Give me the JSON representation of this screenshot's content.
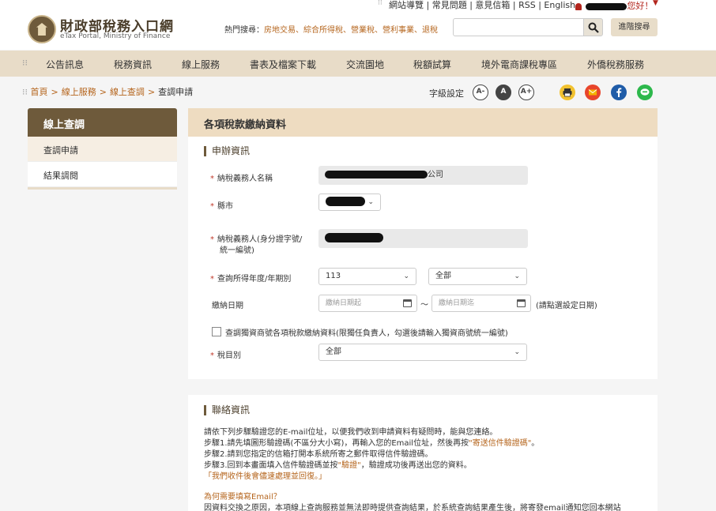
{
  "util": {
    "links": "網站導覽 | 常見問題 | 意見信箱 | RSS | English",
    "greeting": "您好！"
  },
  "header": {
    "brand_cn": "財政部稅務入口網",
    "brand_en": "eTax Portal, Ministry of Finance",
    "hot_label": "熱門搜尋：",
    "hot_keywords": "房地交易、綜合所得稅、營業稅、營利事業、退稅",
    "search_placeholder": "",
    "advanced_search": "進階搜尋"
  },
  "nav": {
    "items": [
      "公告訊息",
      "稅務資訊",
      "線上服務",
      "書表及檔案下載",
      "交流園地",
      "稅額試算",
      "境外電商課稅專區",
      "外僑稅務服務"
    ]
  },
  "breadcrumb": {
    "home": "首頁",
    "level1": "線上服務",
    "level2": "線上查調",
    "current": "查調申請",
    "sep": ">"
  },
  "font_size": {
    "label": "字級設定",
    "small": "A-",
    "normal": "A",
    "large": "A+"
  },
  "sidebar": {
    "title": "線上查調",
    "items": [
      "查調申請",
      "結果調閱"
    ]
  },
  "form": {
    "card_title": "各項稅款繳納資料",
    "section_title": "申辦資訊",
    "taxpayer_name_label": "納稅義務人名稱",
    "taxpayer_name_suffix": "公司",
    "city_label": "縣市",
    "taxpayer_id_label": "納稅義務人(身分證字號/",
    "taxpayer_id_label2": "統一編號)",
    "year_label": "查詢所得年度/年期別",
    "year_value": "113",
    "period_value": "全部",
    "pay_date_label": "繳納日期",
    "date_from_placeholder": "繳納日期起",
    "date_sep": "～",
    "date_to_placeholder": "繳納日期迄",
    "date_hint": "(請點選設定日期)",
    "sole_prop_checkbox": "查調獨資商號各項稅款繳納資料(限獨任負責人，勾選後請輸入獨資商號統一編號)",
    "tax_type_label": "稅目別",
    "tax_type_value": "全部"
  },
  "contact": {
    "section_title": "聯絡資訊",
    "intro": "請依下列步驟驗證您的E-mail位址，以便我們收到申請資料有疑問時，能與您連絡。",
    "step1_a": "步驟1.請先填圖形驗證碼(不區分大小寫)，再輸入您的Email位址，然後再按",
    "step1_link": "\"寄送信件驗證碼\"",
    "step1_b": "。",
    "step2": "步驟2.請到您指定的信箱打開本系統所寄之郵件取得信件驗證碼。",
    "step3_a": "步驟3.回到本畫面填入信件驗證碼並按",
    "step3_link": "\"驗證\"",
    "step3_b": "，驗證成功後再送出您的資料。",
    "reply_note": "「我們收件後會儘速處理並回復。」",
    "why_title": "為何需要填寫Email？",
    "why_text": "因資料交換之原因，本項線上查詢服務並無法即時提供查詢結果，於系統查詢結果產生後，將寄發email通知您回本網站"
  },
  "colors": {
    "brand_brown": "#6e5a3b",
    "nav_bg": "#e8dcc8",
    "accent_link": "#b5651d",
    "required": "#c0392b"
  }
}
